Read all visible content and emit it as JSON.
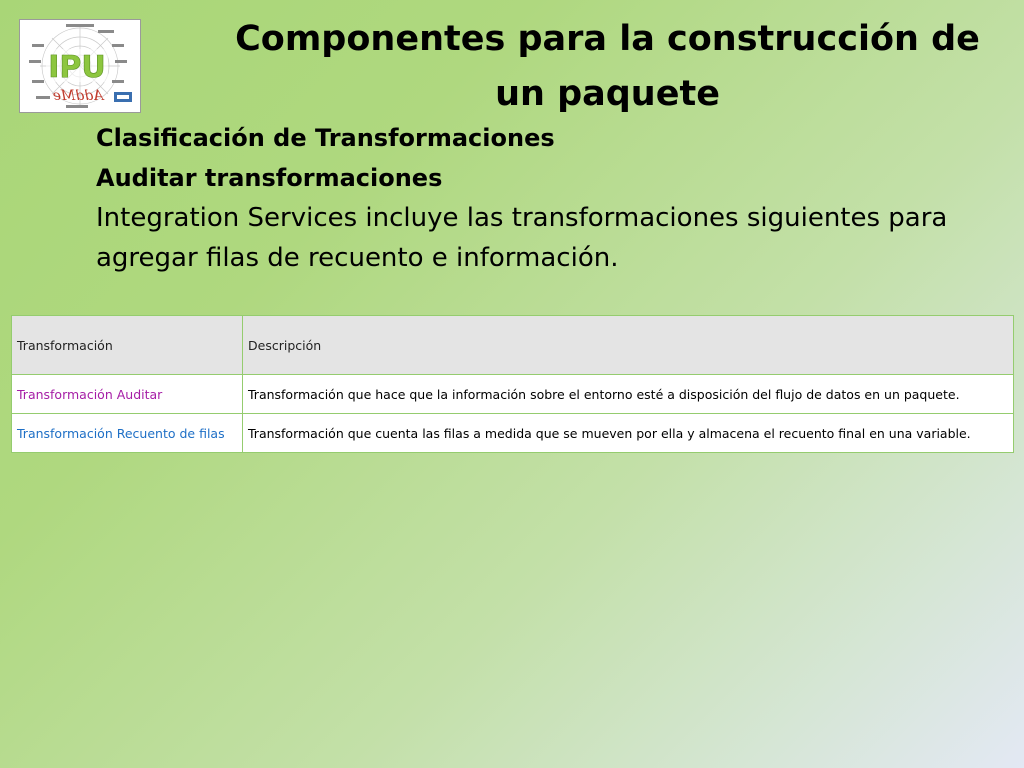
{
  "slide": {
    "title": "Componentes para la construcción de un paquete",
    "sub_heading_1": "Clasificación de Transformaciones",
    "sub_heading_2": "Auditar transformaciones",
    "paragraph": "Integration Services incluye las transformaciones siguientes para agregar filas de recuento e información."
  },
  "logo": {
    "letters": "IPU",
    "mirrored_text": "AddMe"
  },
  "table": {
    "headers": [
      "Transformación",
      "Descripción"
    ],
    "rows": [
      {
        "name": "Transformación Auditar",
        "name_color": "#a61ea6",
        "description": "Transformación que hace que la información sobre el entorno esté a disposición del flujo de datos en un paquete."
      },
      {
        "name": "Transformación Recuento de filas",
        "name_color": "#1e6fc6",
        "description": "Transformación que cuenta las filas a medida que se mueven por ella y almacena el recuento final en una variable."
      }
    ]
  },
  "colors": {
    "background": "#afd87f",
    "table_border": "#95cc6f",
    "header_fill": "#e4e4e4"
  }
}
